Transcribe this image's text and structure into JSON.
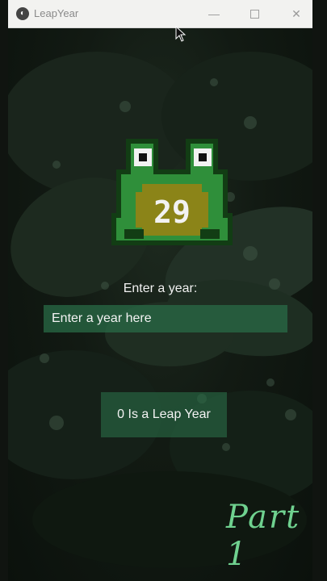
{
  "window": {
    "title": "LeapYear",
    "controls": {
      "minimize": "—",
      "maximize": "",
      "close": "✕"
    }
  },
  "badge_number": "29",
  "prompt_label": "Enter a year:",
  "year_input": {
    "value": "",
    "placeholder": "Enter a year here"
  },
  "result_text": "0 Is a Leap Year",
  "caption": "Part 1",
  "colors": {
    "accent_green": "#2a6e48",
    "frog_green": "#2f8f3a",
    "caption_green": "#6fd18f"
  },
  "icons": [
    "app-logo-icon",
    "frog-mascot-icon",
    "mouse-cursor-icon"
  ]
}
